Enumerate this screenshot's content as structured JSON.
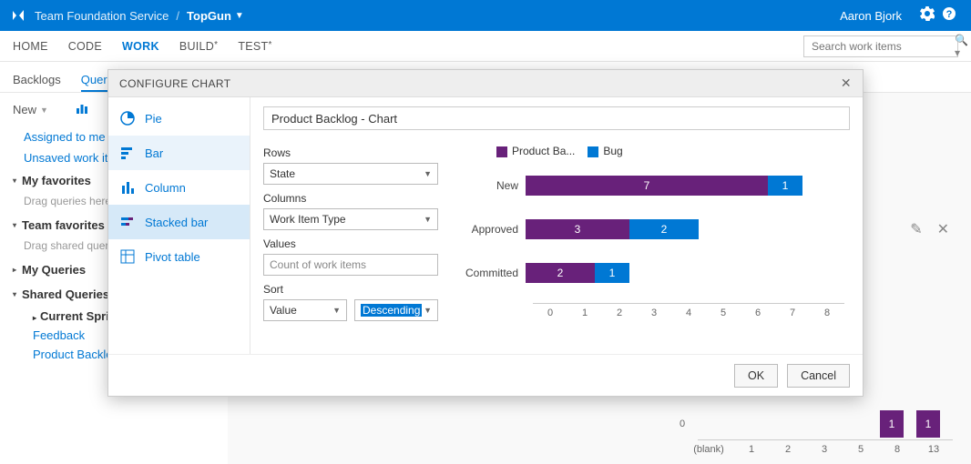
{
  "header": {
    "service": "Team Foundation Service",
    "project": "TopGun",
    "user": "Aaron Bjork"
  },
  "nav": {
    "items": [
      "HOME",
      "CODE",
      "WORK",
      "BUILD",
      "TEST"
    ],
    "active": "WORK",
    "search_placeholder": "Search work items"
  },
  "subnav": {
    "items": [
      "Backlogs",
      "Queries"
    ],
    "active": "Queries"
  },
  "sidebar": {
    "new_label": "New",
    "links": [
      "Assigned to me",
      "Unsaved work items"
    ],
    "sections": {
      "my_favorites": {
        "label": "My favorites",
        "hint": "Drag queries here"
      },
      "team_favorites": {
        "label": "Team favorites",
        "hint": "Drag shared queries"
      },
      "my_queries": {
        "label": "My Queries"
      },
      "shared_queries": {
        "label": "Shared Queries",
        "children": [
          {
            "label": "Current Sprint",
            "bold": true
          },
          {
            "label": "Feedback",
            "blue": true
          },
          {
            "label": "Product Backlog",
            "blue": true
          }
        ]
      }
    }
  },
  "bg_chart": {
    "zero": "0",
    "bars": [
      {
        "h": 30,
        "v": "1"
      },
      {
        "h": 30,
        "v": "1"
      }
    ],
    "labels": [
      "(blank)",
      "1",
      "2",
      "3",
      "5",
      "8",
      "13"
    ]
  },
  "modal": {
    "title": "CONFIGURE CHART",
    "chart_title": "Product Backlog - Chart",
    "types": [
      "Pie",
      "Bar",
      "Column",
      "Stacked bar",
      "Pivot table"
    ],
    "selected_type": "Stacked bar",
    "fields": {
      "rows_label": "Rows",
      "rows_value": "State",
      "cols_label": "Columns",
      "cols_value": "Work Item Type",
      "values_label": "Values",
      "values_value": "Count of work items",
      "sort_label": "Sort",
      "sort_field": "Value",
      "sort_dir": "Descending"
    },
    "legend": {
      "series1": "Product Ba...",
      "series2": "Bug"
    },
    "buttons": {
      "ok": "OK",
      "cancel": "Cancel"
    }
  },
  "chart_data": {
    "type": "bar",
    "orientation": "horizontal",
    "stacked": true,
    "categories": [
      "New",
      "Approved",
      "Committed"
    ],
    "series": [
      {
        "name": "Product Backlog Item",
        "color": "#68217a",
        "values": [
          7,
          3,
          2
        ]
      },
      {
        "name": "Bug",
        "color": "#0078d4",
        "values": [
          1,
          2,
          1
        ]
      }
    ],
    "xlim": [
      0,
      8
    ],
    "xticks": [
      0,
      1,
      2,
      3,
      4,
      5,
      6,
      7,
      8
    ],
    "title": "Product Backlog - Chart"
  }
}
